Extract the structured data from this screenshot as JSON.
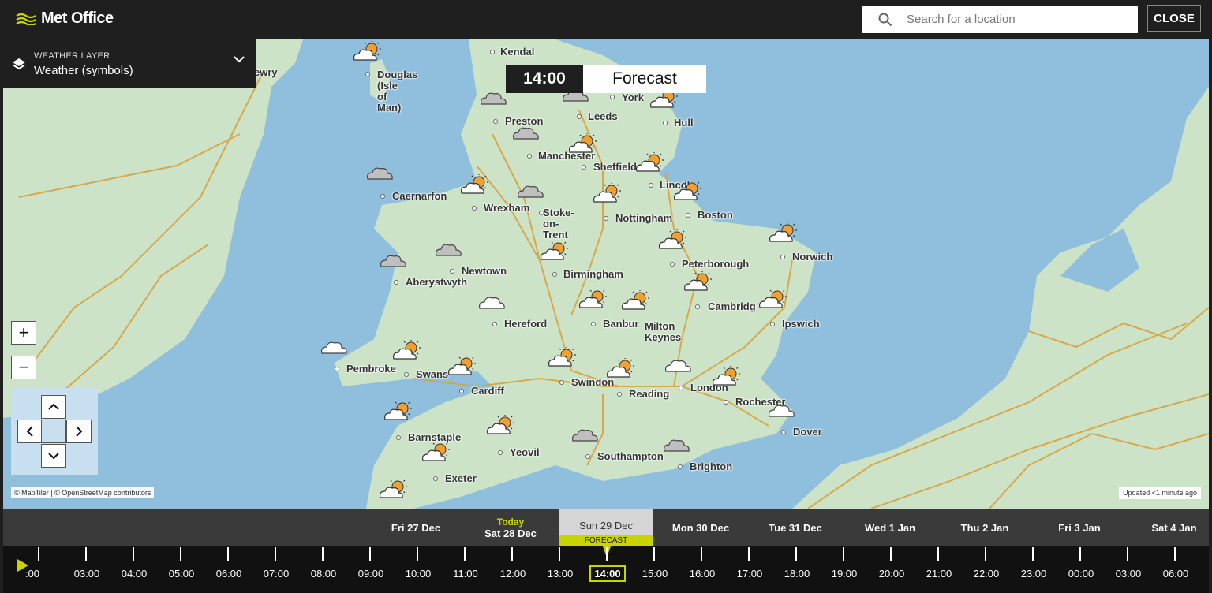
{
  "header": {
    "logo_text": "Met Office",
    "search_placeholder": "Search for a location",
    "close_label": "CLOSE"
  },
  "layer": {
    "label": "WEATHER LAYER",
    "value": "Weather (symbols)"
  },
  "time_badge": {
    "time": "14:00",
    "mode": "Forecast"
  },
  "map": {
    "zoom_in": "+",
    "zoom_out": "−",
    "attribution": "© MapTiler | © OpenStreetMap contributors",
    "updated": "Updated <1 minute ago",
    "cities": [
      {
        "name": "Kendal"
      },
      {
        "name": "Douglas\n(Isle\nof\nMan)"
      },
      {
        "name": "ewry"
      },
      {
        "name": "York"
      },
      {
        "name": "Preston"
      },
      {
        "name": "Leeds"
      },
      {
        "name": "Hull"
      },
      {
        "name": "Manchester"
      },
      {
        "name": "Sheffield"
      },
      {
        "name": "Caernarfon"
      },
      {
        "name": "Wrexham"
      },
      {
        "name": "Lincol"
      },
      {
        "name": "Stoke-\non-\nTrent"
      },
      {
        "name": "Nottingham"
      },
      {
        "name": "Boston"
      },
      {
        "name": "Norwich"
      },
      {
        "name": "Newtown"
      },
      {
        "name": "Birmingham"
      },
      {
        "name": "Peterborough"
      },
      {
        "name": "Aberystwyth"
      },
      {
        "name": "Cambridg"
      },
      {
        "name": "Hereford"
      },
      {
        "name": "Banbur"
      },
      {
        "name": "Milton\nKeynes"
      },
      {
        "name": "Ipswich"
      },
      {
        "name": "Pembroke"
      },
      {
        "name": "Swans"
      },
      {
        "name": "Cardiff"
      },
      {
        "name": "Swindon"
      },
      {
        "name": "Reading"
      },
      {
        "name": "London"
      },
      {
        "name": "Rochester"
      },
      {
        "name": "Dover"
      },
      {
        "name": "Barnstaple"
      },
      {
        "name": "Yeovil"
      },
      {
        "name": "Southampton"
      },
      {
        "name": "Brighton"
      },
      {
        "name": "Exeter"
      }
    ]
  },
  "timeline": {
    "days": [
      {
        "label": "Fri 27 Dec",
        "sub": ""
      },
      {
        "label": "Sat 28 Dec",
        "sub": "Today"
      },
      {
        "label": "Sun 29 Dec",
        "sub": "",
        "tag": "FORECAST"
      },
      {
        "label": "Mon 30 Dec",
        "sub": ""
      },
      {
        "label": "Tue 31 Dec",
        "sub": ""
      },
      {
        "label": "Wed 1 Jan",
        "sub": ""
      },
      {
        "label": "Thu 2 Jan",
        "sub": ""
      },
      {
        "label": "Fri 3 Jan",
        "sub": ""
      },
      {
        "label": "Sat 4 Jan",
        "sub": ""
      }
    ],
    "hours": [
      ":00",
      "03:00",
      "04:00",
      "05:00",
      "06:00",
      "07:00",
      "08:00",
      "09:00",
      "10:00",
      "11:00",
      "12:00",
      "13:00",
      "14:00",
      "15:00",
      "16:00",
      "17:00",
      "18:00",
      "19:00",
      "20:00",
      "21:00",
      "22:00",
      "23:00",
      "00:00",
      "03:00",
      "06:00"
    ],
    "selected_hour": "14:00"
  }
}
